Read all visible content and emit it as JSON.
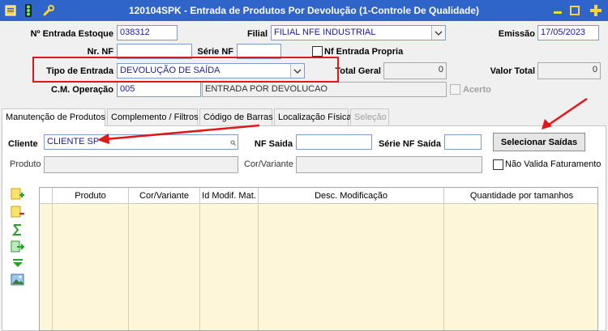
{
  "window": {
    "title": "120104SPK - Entrada de Produtos Por Devolução (1-Controle De Qualidade)"
  },
  "form": {
    "entrada_label": "Nº Entrada Estoque",
    "entrada_value": "038312",
    "filial_label": "Filial",
    "filial_value": "FILIAL NFE INDUSTRIAL",
    "emissao_label": "Emissão",
    "emissao_value": "17/05/2023",
    "nrnf_label": "Nr. NF",
    "nrnf_value": "",
    "serienf_label": "Série NF",
    "serienf_value": "",
    "nfpropria_label": "Nf Entrada Propria",
    "tipo_label": "Tipo de Entrada",
    "tipo_value": "DEVOLUÇÃO DE SAÍDA",
    "totalgeral_label": "Total Geral",
    "totalgeral_value": "0",
    "valortotal_label": "Valor Total",
    "valortotal_value": "0",
    "cmop_label": "C.M. Operação",
    "cmop_code": "005",
    "cmop_desc": "ENTRADA POR DEVOLUCAO",
    "acerto_label": "Acerto"
  },
  "tabs": [
    {
      "label": "Manutenção de Produtos"
    },
    {
      "label": "Complemento / Filtros"
    },
    {
      "label": "Código de Barras"
    },
    {
      "label": "Localização Física"
    },
    {
      "label": "Seleção"
    }
  ],
  "panel": {
    "cliente_label": "Cliente",
    "cliente_value": "CLIENTE SP",
    "nfsaida_label": "NF Saida",
    "nfsaida_value": "",
    "serienfsaida_label": "Série NF Saída",
    "serienfsaida_value": "",
    "selecionar_label": "Selecionar Saídas",
    "produto_label": "Produto",
    "produto_value": "",
    "corvariante_label": "Cor/Variante",
    "corvariante_value": "",
    "naovalida_label": "Não Valida Faturamento"
  },
  "grid": {
    "columns": [
      "Produto",
      "Cor/Variante",
      "Id Modif. Mat.",
      "Desc. Modificação",
      "Quantidade por tamanhos"
    ]
  },
  "colors": {
    "titlebar": "#2f64c8",
    "highlight": "#e01818",
    "grid_bg": "#fdf6d8",
    "input_text": "#1a1aa6"
  }
}
